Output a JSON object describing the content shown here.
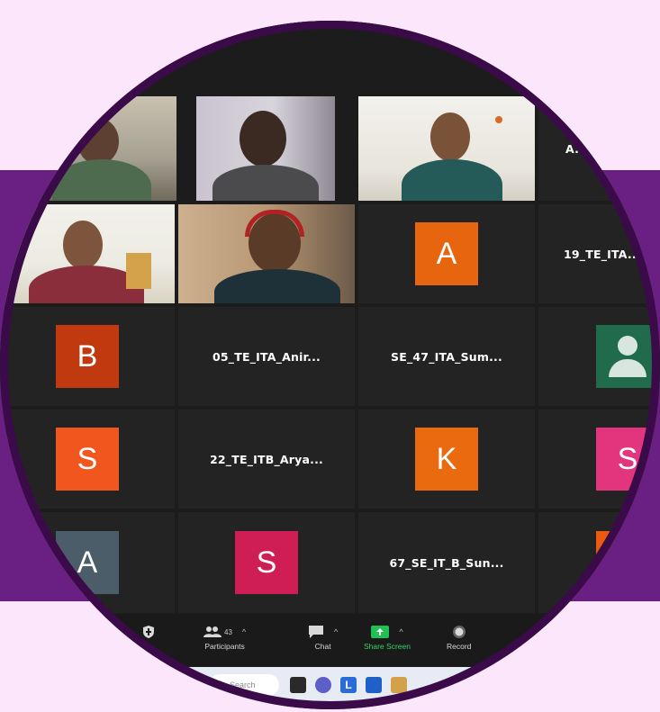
{
  "colors": {
    "page_background": "#fbe6fb",
    "purple_band": "#6a1f82",
    "ring": "#3a0b48",
    "tile_background": "#232323",
    "active_speaker_border": "#cfe34a",
    "share_screen_green": "#1fc152"
  },
  "participants": [
    {
      "kind": "video",
      "description": "participant-1"
    },
    {
      "kind": "video",
      "description": "participant-2"
    },
    {
      "kind": "video",
      "description": "participant-3"
    },
    {
      "kind": "name",
      "name": "A..."
    },
    {
      "kind": "video",
      "description": "participant-5"
    },
    {
      "kind": "video",
      "description": "participant-6"
    },
    {
      "kind": "avatar",
      "letter": "A",
      "color": "#e8650f"
    },
    {
      "kind": "name",
      "name": "19_TE_ITA..."
    },
    {
      "kind": "avatar",
      "letter": "B",
      "color": "#c0390f"
    },
    {
      "kind": "name",
      "name": "05_TE_ITA_Anir..."
    },
    {
      "kind": "name",
      "name": "SE_47_ITA_Sum..."
    },
    {
      "kind": "avatar_icon",
      "icon": "person-icon",
      "color": "#1f6b4c"
    },
    {
      "kind": "avatar",
      "letter": "S",
      "color": "#f0561d"
    },
    {
      "kind": "name",
      "name": "22_TE_ITB_Arya..."
    },
    {
      "kind": "avatar",
      "letter": "K",
      "color": "#ea6a10"
    },
    {
      "kind": "avatar",
      "letter": "S",
      "color": "#e2357d"
    },
    {
      "kind": "avatar",
      "letter": "A",
      "color": "#4a5d68"
    },
    {
      "kind": "avatar",
      "letter": "S",
      "color": "#cf1e56"
    },
    {
      "kind": "name",
      "name": "67_SE_IT_B_Sun..."
    },
    {
      "kind": "avatar",
      "letter": "",
      "color": "#ea5a10"
    }
  ],
  "toolbar": {
    "security_icon": "shield-icon",
    "participants_label": "Participants",
    "participants_count": "43",
    "chat_label": "Chat",
    "share_label": "Share Screen",
    "record_label": "Record"
  },
  "taskbar": {
    "search_placeholder": "Search",
    "apps": [
      "task-view-icon",
      "chat-app-icon",
      "l-app-icon",
      "file-explorer-icon"
    ]
  }
}
